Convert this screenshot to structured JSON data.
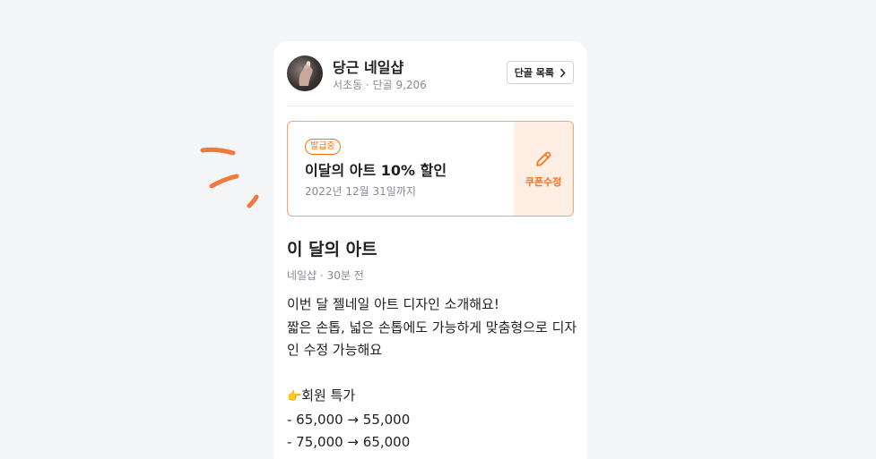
{
  "shop": {
    "name": "당근 네일샵",
    "meta": "서초동 · 단골 9,206",
    "regular_list_label": "단골 목록"
  },
  "coupon": {
    "badge": "발급중",
    "title": "이달의 아트 10% 할인",
    "date": "2022년 12월 31일까지",
    "edit_label": "쿠폰수정"
  },
  "post": {
    "title": "이 달의 아트",
    "meta": "네일샵 · 30분 전",
    "lines": [
      "이번 달 젤네일 아트 디자인 소개해요!",
      "짧은 손톱, 넓은 손톱에도 가능하게 맞춤형으로 디자",
      "인 수정 가능해요"
    ],
    "member_price_label": "회원 특가",
    "prices": [
      " - 65,000 → 55,000",
      " - 75,000 → 65,000"
    ]
  },
  "colors": {
    "accent": "#ff6f0f",
    "coupon_border": "#ff9f6b",
    "coupon_side_bg": "#ffeee4",
    "deco": "#f07a3c"
  },
  "icons": {
    "edit": "pencil-icon",
    "chevron": "chevron-right-icon",
    "point": "pointing-hand-icon"
  }
}
